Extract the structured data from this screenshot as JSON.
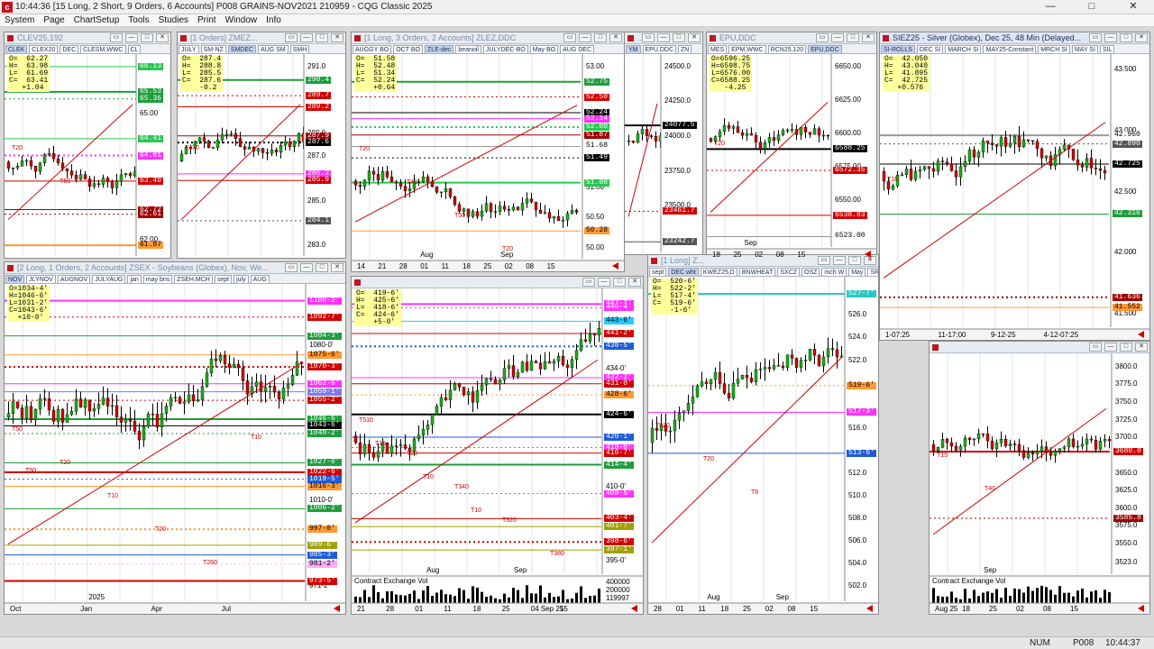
{
  "app": {
    "title": "10:44:36   [15 Long, 2 Short, 9 Orders, 6 Accounts]   P008 GRAINS-NOV2021   210959 - CQG Classic 2025",
    "menu": [
      "System",
      "Page",
      "ChartSetup",
      "Tools",
      "Studies",
      "Print",
      "Window",
      "Info"
    ],
    "status": {
      "num": "NUM",
      "page": "P008",
      "time": "10:44:37"
    }
  },
  "windows": [
    {
      "id": "clev",
      "title": "CLEV25,192",
      "tabs": [
        "CLEK",
        "CLEX20",
        "DEC",
        "CLESM,WWC",
        "CL"
      ],
      "ohlc": [
        "O=  62.27",
        "H=  63.98",
        "L=  61.69",
        "C=  63.41",
        "   +1.04"
      ],
      "axis": [
        "65.53",
        "65.36",
        "66.13",
        "65.00",
        "64.41",
        "64.01",
        "63.40",
        "62.72",
        "62.61",
        "62.00",
        "61.87"
      ],
      "dates": [
        "Sep"
      ],
      "markers": [
        "T20",
        "T60"
      ],
      "badges": [
        {
          "v": "65.53",
          "bg": "#1e9e3c",
          "fg": "#ffffff"
        },
        {
          "v": "65.36",
          "bg": "#1e9e3c",
          "fg": "#ffffff"
        },
        {
          "v": "66.13",
          "bg": "#28c850",
          "fg": "#ffffff"
        },
        {
          "v": "64.41",
          "bg": "#28c850",
          "fg": "#ffffff"
        },
        {
          "v": "64.01",
          "bg": "#ff32ff",
          "fg": "#ffffff"
        },
        {
          "v": "63.40",
          "bg": "#d30000",
          "fg": "#ffffff"
        },
        {
          "v": "62.72",
          "bg": "#a00000",
          "fg": "#ffffff"
        },
        {
          "v": "62.61",
          "bg": "#a00000",
          "fg": "#ffffff"
        },
        {
          "v": "61.87",
          "bg": "#ff9933",
          "fg": "#000000"
        }
      ]
    },
    {
      "id": "zmez",
      "title": "[1 Orders]  ZMEZ...",
      "tabs": [
        "JULY",
        "SM-NZ",
        "SMDEC",
        "AUG SM",
        "SMH"
      ],
      "ohlc": [
        "O=  287.4",
        "H=  288.8",
        "L=  285.5",
        "C=  287.6",
        "    -0.2"
      ],
      "axis": [
        "291.0",
        "290.4",
        "289.7",
        "289.2",
        "288.0",
        "287.9",
        "287.6",
        "287.0",
        "286.2",
        "285.9",
        "285.0",
        "284.1",
        "283.0"
      ],
      "markers": [
        "T470"
      ],
      "badges": [
        {
          "v": "290.4",
          "bg": "#1e9e3c",
          "fg": "#ffffff"
        },
        {
          "v": "289.7",
          "bg": "#d30000",
          "fg": "#ffffff"
        },
        {
          "v": "289.2",
          "bg": "#d30000",
          "fg": "#ffffff"
        },
        {
          "v": "287.9",
          "bg": "#a00000",
          "fg": "#ffffff"
        },
        {
          "v": "287.6",
          "bg": "#000000",
          "fg": "#ffffff"
        },
        {
          "v": "286.2",
          "bg": "#ff32ff",
          "fg": "#ffffff"
        },
        {
          "v": "285.9",
          "bg": "#d30000",
          "fg": "#ffffff"
        },
        {
          "v": "284.1",
          "bg": "#555555",
          "fg": "#ffffff"
        }
      ]
    },
    {
      "id": "zlez",
      "title": "[1 Long, 3 Orders, 2 Accounts]  ZLEZ,DDC",
      "tabs": [
        "AUGGY BO",
        "OCT BO",
        "ZLE-dec",
        "beanoil",
        "JULYDEC-BO",
        "May BO",
        "AUG DEC"
      ],
      "ohlc": [
        "O=  51.58",
        "H=  52.48",
        "L=  51.34",
        "C=  52.24",
        "    +0.64"
      ],
      "axis": [
        "53.00",
        "52.75",
        "52.50",
        "52.24",
        "52.00",
        "51.68",
        "51.49",
        "51.00",
        "50.50",
        "50.28",
        "50.00"
      ],
      "dates": [
        "14",
        "21",
        "28",
        "01",
        "11",
        "18",
        "25",
        "02",
        "08",
        "15"
      ],
      "month_labels": [
        "Aug",
        "Sep"
      ],
      "markers": [
        "T20",
        "T42",
        "T50",
        "T20"
      ],
      "badges": [
        {
          "v": "52.75",
          "bg": "#1e9e3c",
          "fg": "#ffffff"
        },
        {
          "v": "52.50",
          "bg": "#d30000",
          "fg": "#ffffff"
        },
        {
          "v": "52.24",
          "bg": "#000000",
          "fg": "#ffffff"
        },
        {
          "v": "52.14",
          "bg": "#ff32ff",
          "fg": "#ffffff"
        },
        {
          "v": "52.00",
          "bg": "#28c850",
          "fg": "#ffffff"
        },
        {
          "v": "51.87",
          "bg": "#a00000",
          "fg": "#ffffff"
        },
        {
          "v": "51.68",
          "bg": "#ffffff",
          "fg": "#000000"
        },
        {
          "v": "51.49",
          "bg": "#000000",
          "fg": "#ffffff"
        },
        {
          "v": "51.08",
          "bg": "#28c850",
          "fg": "#ffffff"
        },
        {
          "v": "50.28",
          "bg": "#ff9933",
          "fg": "#000000"
        }
      ]
    },
    {
      "id": "ym",
      "title": "...",
      "tabs": [
        "YM",
        "EPU,DDC",
        "ZN"
      ],
      "axis": [
        "24500.0",
        "24250.0",
        "24077.5",
        "24000.0",
        "23750.0",
        "23500.0",
        "23461.7",
        "23242.7"
      ],
      "markers": [],
      "badges": [
        {
          "v": "24077.5",
          "bg": "#000000",
          "fg": "#ffffff"
        },
        {
          "v": "23461.7",
          "bg": "#d30000",
          "fg": "#ffffff"
        },
        {
          "v": "23242.7",
          "bg": "#555555",
          "fg": "#ffffff"
        }
      ]
    },
    {
      "id": "epu",
      "title": "EPU,DDC",
      "tabs": [
        "MES",
        "EPM,WWC",
        "RCN25,120",
        "EPU,DDC"
      ],
      "ohlc": [
        "O=6596.25",
        "H=6598.75",
        "L=6576.00",
        "C=6588.25",
        "   -4.25"
      ],
      "axis": [
        "6650.00",
        "6625.00",
        "6600.00",
        "6588.25",
        "6575.00",
        "6572.35",
        "6550.00",
        "6538.83",
        "6523.00"
      ],
      "dates": [
        "18",
        "25",
        "02",
        "08",
        "15"
      ],
      "month_labels": [
        "Sep"
      ],
      "markers": [
        "T20"
      ],
      "badges": [
        {
          "v": "6588.25",
          "bg": "#000000",
          "fg": "#ffffff"
        },
        {
          "v": "6572.35",
          "bg": "#d30000",
          "fg": "#ffffff"
        },
        {
          "v": "6538.83",
          "bg": "#d30000",
          "fg": "#ffffff"
        },
        {
          "v": "6523.00",
          "bg": "#ffffff",
          "fg": "#000000"
        }
      ]
    },
    {
      "id": "siez",
      "title": "SIEZ25 - Silver (Globex), Dec 25, 48 Min (Delayed...",
      "tabs": [
        "SI-ROLLS",
        "DEC SI",
        "MARCH SI",
        "MAY25-Constant",
        "MRCH SI",
        "MAY SI",
        "SIL"
      ],
      "ohlc": [
        "O=  42.050",
        "H=  43.040",
        "L=  41.895",
        "C=  42.725",
        "   +0.576"
      ],
      "axis": [
        "43.500",
        "43.000",
        "42.960",
        "42.890",
        "42.725",
        "42.500",
        "42.316",
        "42.000",
        "41.636",
        "41.552",
        "41.500"
      ],
      "dates": [
        "1-07:25",
        "11-17:00",
        "9-12-25",
        "4-12-07:25"
      ],
      "markers": [
        "T16"
      ],
      "badges": [
        {
          "v": "42.960",
          "bg": "#ffffff",
          "fg": "#000000"
        },
        {
          "v": "42.890",
          "bg": "#555555",
          "fg": "#ffffff"
        },
        {
          "v": "42.725",
          "bg": "#000000",
          "fg": "#ffffff"
        },
        {
          "v": "42.316",
          "bg": "#1e9e3c",
          "fg": "#ffffff"
        },
        {
          "v": "41.636",
          "bg": "#a00000",
          "fg": "#ffffff"
        },
        {
          "v": "41.552",
          "bg": "#ff9933",
          "fg": "#000000"
        }
      ]
    },
    {
      "id": "zsex",
      "title": "[2 Long, 1 Orders, 2 Accounts]  ZSEX - Soybeans (Globex), Nov, We...",
      "tabs": [
        "NOV",
        "JLYNOV",
        "AUGNOV",
        "JULYAUG",
        "jan",
        "may bns",
        "ZSEH,MCH",
        "sept",
        "july",
        "AUG"
      ],
      "ohlc": [
        "O=1034-4'",
        "H=1046-6'",
        "L=1031-2'",
        "C=1043-6'",
        "  +10-0'"
      ],
      "axis": [
        "1100-2'",
        "1092-7'",
        "1084-3'",
        "1080-0'",
        "1075-6'",
        "1070-3'",
        "1062-6'",
        "1059-1'",
        "1055-2'",
        "1046-6'",
        "1043-6'",
        "1040-2'",
        "1027-0'",
        "1022-6'",
        "1019-5'",
        "1016-3'",
        "1010-0'",
        "1006-2'",
        "997-0'",
        "989-6'",
        "985-3'",
        "981-2'",
        "973-5'",
        "971-2'"
      ],
      "dates": [
        "Oct",
        "Jan",
        "Apr",
        "Jul"
      ],
      "year_label": "2025",
      "markers": [
        "T50",
        "T20",
        "T10",
        "T20",
        "T260",
        "T10",
        "T50"
      ],
      "badges": [
        {
          "v": "1100-2'",
          "bg": "#ff32ff",
          "fg": "#ffffff"
        },
        {
          "v": "1092-7'",
          "bg": "#d30000",
          "fg": "#ffffff"
        },
        {
          "v": "1084-3'",
          "bg": "#1e9e3c",
          "fg": "#ffffff"
        },
        {
          "v": "1075-6'",
          "bg": "#ff9933",
          "fg": "#000000"
        },
        {
          "v": "1070-3'",
          "bg": "#d30000",
          "fg": "#ffffff"
        },
        {
          "v": "1062-6'",
          "bg": "#ff32ff",
          "fg": "#ffffff"
        },
        {
          "v": "1059-1'",
          "bg": "#7c7cf0",
          "fg": "#ffffff"
        },
        {
          "v": "1055-2'",
          "bg": "#d30000",
          "fg": "#ffffff"
        },
        {
          "v": "1046-6'",
          "bg": "#1e9e3c",
          "fg": "#ffffff"
        },
        {
          "v": "1043-6'",
          "bg": "#000000",
          "fg": "#ffffff"
        },
        {
          "v": "1040-2'",
          "bg": "#1e9e3c",
          "fg": "#ffffff"
        },
        {
          "v": "1027-0'",
          "bg": "#1e9e3c",
          "fg": "#ffffff"
        },
        {
          "v": "1022-6'",
          "bg": "#d30000",
          "fg": "#ffffff"
        },
        {
          "v": "1019-5'",
          "bg": "#1e5bd8",
          "fg": "#ffffff"
        },
        {
          "v": "1016-3'",
          "bg": "#ff9933",
          "fg": "#000000"
        },
        {
          "v": "1006-2'",
          "bg": "#1e9e3c",
          "fg": "#ffffff"
        },
        {
          "v": "997-0'",
          "bg": "#ff9933",
          "fg": "#000000"
        },
        {
          "v": "989-6'",
          "bg": "#a0a000",
          "fg": "#ffffff"
        },
        {
          "v": "985-3'",
          "bg": "#1e5bd8",
          "fg": "#ffffff"
        },
        {
          "v": "981-2'",
          "bg": "#ffaaff",
          "fg": "#000000"
        },
        {
          "v": "973-5'",
          "bg": "#d30000",
          "fg": "#ffffff"
        }
      ]
    },
    {
      "id": "corn",
      "title": "",
      "tabs": [],
      "ohlc": [
        "O=  419-6'",
        "H=  425-6'",
        "L=  418-6'",
        "C=  424-6'",
        "    +5-0'"
      ],
      "axis": [
        "447-2'",
        "446-4'",
        "443-6'",
        "441-2'",
        "438-5'",
        "434-0'",
        "432-2'",
        "431-0'",
        "428-6'",
        "424-6'",
        "420-1'",
        "418-0'",
        "416-7'",
        "414-4'",
        "410-0'",
        "408-5'",
        "403-4'",
        "401-7'",
        "398-6'",
        "397-1'",
        "395-0'"
      ],
      "vol_axis": [
        "400000",
        "200000",
        "119997"
      ],
      "volume_label": "Contract Exchange Vol",
      "dates": [
        "21",
        "28",
        "01",
        "11",
        "18",
        "25",
        "04 Sep 25",
        "15"
      ],
      "month_labels": [
        "Aug",
        "Sep"
      ],
      "markers": [
        "T510",
        "T20",
        "T340",
        "T320",
        "T380",
        "T15",
        "T10",
        "T10"
      ],
      "badges": [
        {
          "v": "447-2'",
          "bg": "#ff32ff",
          "fg": "#ffffff"
        },
        {
          "v": "446-4'",
          "bg": "#ff32ff",
          "fg": "#ffffff"
        },
        {
          "v": "443-6'",
          "bg": "#28c8ff",
          "fg": "#000000"
        },
        {
          "v": "441-2'",
          "bg": "#d30000",
          "fg": "#ffffff"
        },
        {
          "v": "438-5'",
          "bg": "#1e5bd8",
          "fg": "#ffffff"
        },
        {
          "v": "432-2'",
          "bg": "#ff32ff",
          "fg": "#ffffff"
        },
        {
          "v": "431-0'",
          "bg": "#d30000",
          "fg": "#ffffff"
        },
        {
          "v": "428-6'",
          "bg": "#ff9933",
          "fg": "#000000"
        },
        {
          "v": "424-6'",
          "bg": "#000000",
          "fg": "#ffffff"
        },
        {
          "v": "420-1'",
          "bg": "#1e5bd8",
          "fg": "#ffffff"
        },
        {
          "v": "418-0'",
          "bg": "#ff32ff",
          "fg": "#ffffff"
        },
        {
          "v": "416-7'",
          "bg": "#d30000",
          "fg": "#ffffff"
        },
        {
          "v": "414-4'",
          "bg": "#1e9e3c",
          "fg": "#ffffff"
        },
        {
          "v": "408-5'",
          "bg": "#ff32ff",
          "fg": "#ffffff"
        },
        {
          "v": "403-4'",
          "bg": "#d30000",
          "fg": "#ffffff"
        },
        {
          "v": "401-7'",
          "bg": "#a0a000",
          "fg": "#ffffff"
        },
        {
          "v": "398-6'",
          "bg": "#d30000",
          "fg": "#ffffff"
        },
        {
          "v": "397-1'",
          "bg": "#a0a000",
          "fg": "#ffffff"
        }
      ]
    },
    {
      "id": "wheat",
      "title": "[1 Long]  Z...",
      "tabs": [
        "sept",
        "DEC wht",
        "KWEZ25,D",
        "BNWHEAT",
        "SXCZ",
        "OSZ",
        "mch W",
        "May",
        "SR"
      ],
      "ohlc": [
        "O=  520-6'",
        "H=  522-2'",
        "L=  517-4'",
        "C=  519-6'",
        "    -1-6'"
      ],
      "axis": [
        "527-7'",
        "526.0",
        "524.0",
        "522.0",
        "519-6'",
        "517-3'",
        "516.0",
        "513-6'",
        "512.0",
        "510.0",
        "508.0",
        "506.0",
        "504.0",
        "502.0"
      ],
      "dates": [
        "28",
        "01",
        "11",
        "18",
        "25",
        "02",
        "08",
        "15"
      ],
      "month_labels": [
        "Aug",
        "Sep"
      ],
      "markers": [
        "T520",
        "T20",
        "T6"
      ],
      "badges": [
        {
          "v": "527-7'",
          "bg": "#28c8c8",
          "fg": "#ffffff"
        },
        {
          "v": "519-6'",
          "bg": "#ff9933",
          "fg": "#000000"
        },
        {
          "v": "517-3'",
          "bg": "#ff32ff",
          "fg": "#ffffff"
        },
        {
          "v": "513-6'",
          "bg": "#1e5bd8",
          "fg": "#ffffff"
        }
      ]
    },
    {
      "id": "silver2",
      "title": "",
      "tabs": [],
      "axis": [
        "3800.0",
        "3775.0",
        "3750.0",
        "3725.0",
        "3700.0",
        "3680.0",
        "3650.0",
        "3625.0",
        "3600.0",
        "3585.8",
        "3575.0",
        "3550.0",
        "3523.0"
      ],
      "volume_label": "Contract Exchange Vol",
      "dates": [
        "Aug 25",
        "18",
        "25",
        "02",
        "08",
        "15"
      ],
      "month_labels": [
        "Sep"
      ],
      "markers": [
        "T15",
        "T40"
      ],
      "badges": [
        {
          "v": "3680.0",
          "bg": "#d30000",
          "fg": "#ffffff"
        },
        {
          "v": "3585.8",
          "bg": "#a00000",
          "fg": "#ffffff"
        }
      ]
    }
  ]
}
